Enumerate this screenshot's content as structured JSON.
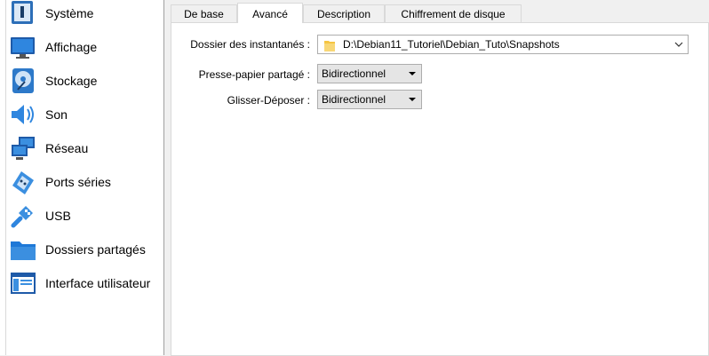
{
  "sidebar": {
    "items": [
      {
        "label": "Système",
        "icon": "system-icon"
      },
      {
        "label": "Affichage",
        "icon": "display-icon"
      },
      {
        "label": "Stockage",
        "icon": "storage-icon"
      },
      {
        "label": "Son",
        "icon": "audio-icon"
      },
      {
        "label": "Réseau",
        "icon": "network-icon"
      },
      {
        "label": "Ports séries",
        "icon": "serial-ports-icon"
      },
      {
        "label": "USB",
        "icon": "usb-icon"
      },
      {
        "label": "Dossiers partagés",
        "icon": "shared-folders-icon"
      },
      {
        "label": "Interface utilisateur",
        "icon": "user-interface-icon"
      }
    ]
  },
  "tabs": [
    {
      "label": "De base"
    },
    {
      "label": "Avancé",
      "active": true
    },
    {
      "label": "Description"
    },
    {
      "label": "Chiffrement de disque"
    }
  ],
  "advanced": {
    "snapshot_folder_label": "Dossier des instantanés :",
    "snapshot_folder_value": "D:\\Debian11_Tutoriel\\Debian_Tuto\\Snapshots",
    "clipboard_label": "Presse-papier partagé :",
    "clipboard_value": "Bidirectionnel",
    "dnd_label": "Glisser-Déposer :",
    "dnd_value": "Bidirectionnel"
  },
  "colors": {
    "accent": "#1e78d7",
    "folder": "#f5c542",
    "border": "#adadad"
  }
}
